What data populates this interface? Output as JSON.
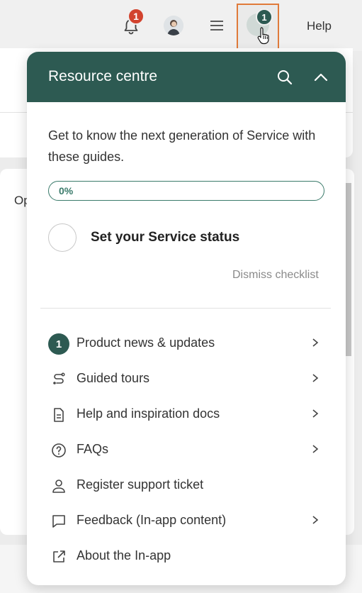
{
  "topbar": {
    "notification_count": "1",
    "resource_badge_count": "1",
    "help_label": "Help"
  },
  "background": {
    "partial_text": "Op"
  },
  "panel": {
    "title": "Resource centre",
    "intro": "Get to know the next generation of Service with these guides.",
    "progress_label": "0%",
    "progress_value": 0,
    "checklist_item": "Set your Service status",
    "dismiss_label": "Dismiss checklist",
    "menu": [
      {
        "label": "Product news & updates",
        "icon": "number-badge",
        "badge": "1"
      },
      {
        "label": "Guided tours",
        "icon": "route-icon"
      },
      {
        "label": "Help and inspiration docs",
        "icon": "document-icon"
      },
      {
        "label": "FAQs",
        "icon": "question-circle-icon"
      },
      {
        "label": "Register support ticket",
        "icon": "person-icon"
      },
      {
        "label": "Feedback (In-app content)",
        "icon": "speech-bubble-icon"
      },
      {
        "label": "About the In-app",
        "icon": "external-link-icon"
      }
    ]
  },
  "colors": {
    "header": "#2d5a52",
    "notification_badge": "#d2432e",
    "highlight_border": "#e07a3a"
  }
}
